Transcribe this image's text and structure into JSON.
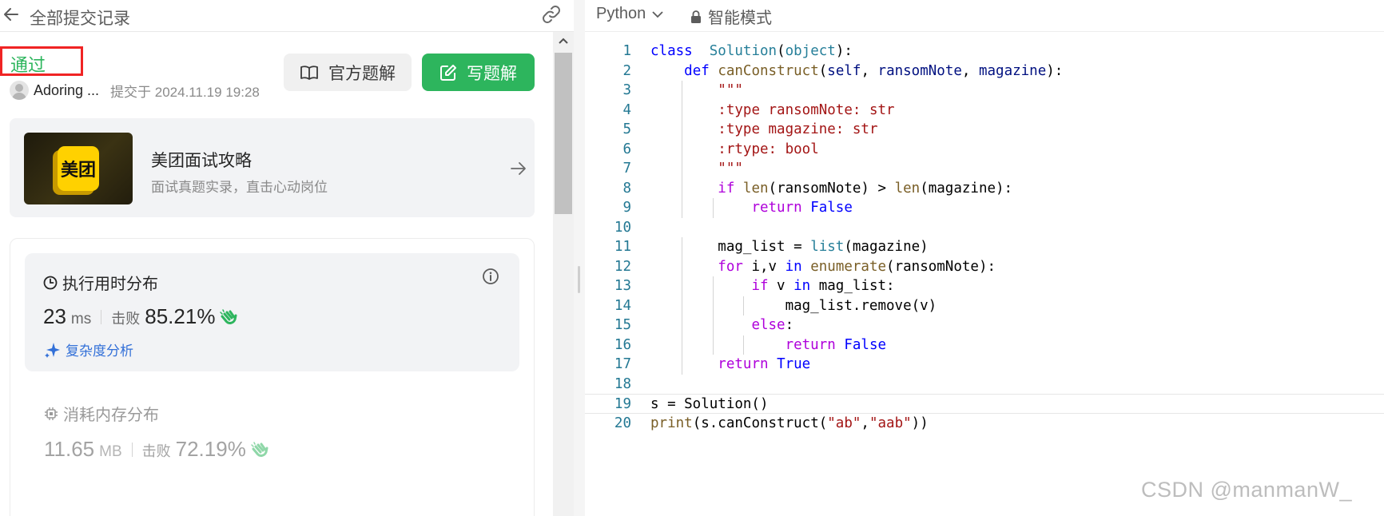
{
  "header": {
    "title": "全部提交记录"
  },
  "submission": {
    "status": "通过",
    "username": "Adoring ...",
    "submitted_at": "提交于 2024.11.19 19:28",
    "btn_official": "官方题解",
    "btn_write": "写题解"
  },
  "promo": {
    "title": "美团面试攻略",
    "subtitle": "面试真题实录，直击心动岗位",
    "logo_text": "美团"
  },
  "runtime": {
    "title": "执行用时分布",
    "value": "23",
    "unit": "ms",
    "beat_label": "击败",
    "percent": "85.21%",
    "complexity": "复杂度分析"
  },
  "memory": {
    "title": "消耗内存分布",
    "value": "11.65",
    "unit": "MB",
    "beat_label": "击败",
    "percent": "72.19%"
  },
  "editor": {
    "language": "Python",
    "mode": "智能模式",
    "current_line": 19,
    "lines": [
      [
        [
          "kw",
          "class"
        ],
        [
          "",
          "  "
        ],
        [
          "cls",
          "Solution"
        ],
        [
          "",
          "("
        ],
        [
          "cls",
          "object"
        ],
        [
          "",
          "):"
        ]
      ],
      [
        [
          "",
          "    "
        ],
        [
          "kw",
          "def"
        ],
        [
          "",
          " "
        ],
        [
          "fn",
          "canConstruct"
        ],
        [
          "",
          "("
        ],
        [
          "prm",
          "self"
        ],
        [
          "",
          ", "
        ],
        [
          "prm",
          "ransomNote"
        ],
        [
          "",
          ", "
        ],
        [
          "prm",
          "magazine"
        ],
        [
          "",
          "):"
        ]
      ],
      [
        [
          "",
          "        "
        ],
        [
          "str",
          "\"\"\""
        ]
      ],
      [
        [
          "",
          "        "
        ],
        [
          "str",
          ":type ransomNote: str"
        ]
      ],
      [
        [
          "",
          "        "
        ],
        [
          "str",
          ":type magazine: str"
        ]
      ],
      [
        [
          "",
          "        "
        ],
        [
          "str",
          ":rtype: bool"
        ]
      ],
      [
        [
          "",
          "        "
        ],
        [
          "str",
          "\"\"\""
        ]
      ],
      [
        [
          "",
          "        "
        ],
        [
          "ctl",
          "if"
        ],
        [
          "",
          " "
        ],
        [
          "fn",
          "len"
        ],
        [
          "",
          "(ransomNote) > "
        ],
        [
          "fn",
          "len"
        ],
        [
          "",
          "(magazine):"
        ]
      ],
      [
        [
          "",
          "            "
        ],
        [
          "ctl",
          "return"
        ],
        [
          "",
          " "
        ],
        [
          "kw",
          "False"
        ]
      ],
      [],
      [
        [
          "",
          "        mag_list = "
        ],
        [
          "cls",
          "list"
        ],
        [
          "",
          "(magazine)"
        ]
      ],
      [
        [
          "",
          "        "
        ],
        [
          "ctl",
          "for"
        ],
        [
          "",
          " i,v "
        ],
        [
          "kw",
          "in"
        ],
        [
          "",
          " "
        ],
        [
          "fn",
          "enumerate"
        ],
        [
          "",
          "(ransomNote):"
        ]
      ],
      [
        [
          "",
          "            "
        ],
        [
          "ctl",
          "if"
        ],
        [
          "",
          " v "
        ],
        [
          "kw",
          "in"
        ],
        [
          "",
          " mag_list:"
        ]
      ],
      [
        [
          "",
          "                mag_list.remove(v)"
        ]
      ],
      [
        [
          "",
          "            "
        ],
        [
          "ctl",
          "else"
        ],
        [
          "",
          ":"
        ]
      ],
      [
        [
          "",
          "                "
        ],
        [
          "ctl",
          "return"
        ],
        [
          "",
          " "
        ],
        [
          "kw",
          "False"
        ]
      ],
      [
        [
          "",
          "        "
        ],
        [
          "ctl",
          "return"
        ],
        [
          "",
          " "
        ],
        [
          "kw",
          "True"
        ]
      ],
      [],
      [
        [
          "",
          "s = Solution()"
        ]
      ],
      [
        [
          "fn",
          "print"
        ],
        [
          "",
          "(s.canConstruct("
        ],
        [
          "str",
          "\"ab\""
        ],
        [
          "",
          ","
        ],
        [
          "str",
          "\"aab\""
        ],
        [
          "",
          "))"
        ]
      ]
    ],
    "guides": [
      [],
      [],
      [
        1
      ],
      [
        1
      ],
      [
        1
      ],
      [
        1
      ],
      [
        1
      ],
      [
        1
      ],
      [
        1,
        2
      ],
      [],
      [
        1
      ],
      [
        1
      ],
      [
        1,
        2
      ],
      [
        1,
        2,
        3
      ],
      [
        1,
        2
      ],
      [
        1,
        2,
        3
      ],
      [
        1
      ],
      [],
      [],
      []
    ]
  },
  "watermark": "CSDN @manmanW_",
  "colors": {
    "accent_green": "#2db55d",
    "status_border": "#f02424",
    "link_blue": "#3370d8"
  }
}
